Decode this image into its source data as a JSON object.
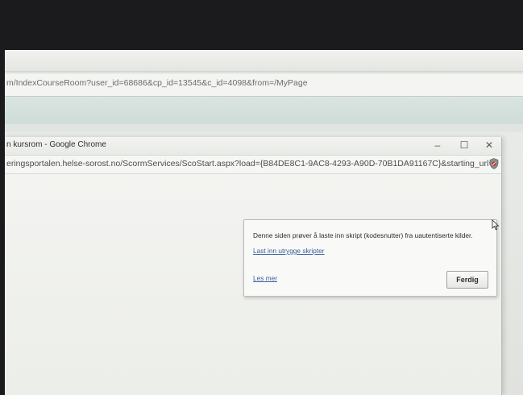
{
  "background_window": {
    "url": "m/IndexCourseRoom?user_id=68686&cp_id=13545&c_id=4098&from=/MyPage"
  },
  "popup_window": {
    "title": "n kursrom - Google Chrome",
    "url": "eringsportalen.helse-sorost.no/ScormServices/ScoStart.aspx?load={B84DE8C1-9AC8-4293-A90D-70B1DA91167C}&starting_url=",
    "controls": {
      "minimize": "–",
      "maximize": "☐",
      "close": "✕"
    }
  },
  "security_bubble": {
    "message": "Denne siden prøver å laste inn skript (kodesnutter) fra uautentiserte kilder.",
    "load_unsafe_link": "Last inn utrygge skripter",
    "learn_more_link": "Les mer",
    "done_button": "Ferdig"
  },
  "icons": {
    "shield": "shield-blocked-icon",
    "cursor": "mouse-pointer-icon"
  }
}
